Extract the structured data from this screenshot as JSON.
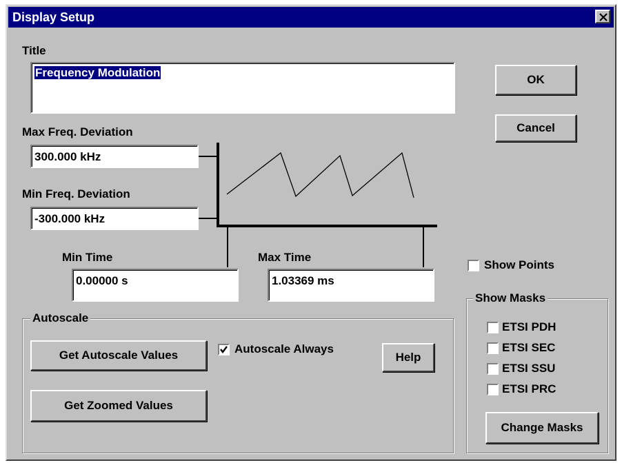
{
  "window": {
    "title": "Display Setup",
    "close_symbol": "✕"
  },
  "title_section": {
    "label": "Title",
    "value": "Frequency Modulation"
  },
  "buttons": {
    "ok": "OK",
    "cancel": "Cancel"
  },
  "max_freq": {
    "label": "Max Freq. Deviation",
    "value": "300.000 kHz"
  },
  "min_freq": {
    "label": "Min Freq. Deviation",
    "value": "-300.000 kHz"
  },
  "min_time": {
    "label": "Min Time",
    "value": "0.00000 s"
  },
  "max_time": {
    "label": "Max Time",
    "value": "1.03369 ms"
  },
  "autoscale": {
    "group_label": "Autoscale",
    "get_autoscale": "Get Autoscale Values",
    "get_zoomed": "Get Zoomed Values",
    "always_label": "Autoscale Always",
    "always_checked": true,
    "help": "Help"
  },
  "show_points": {
    "label": "Show Points",
    "checked": false
  },
  "masks": {
    "group_label": "Show Masks",
    "items": [
      {
        "label": "ETSI PDH",
        "checked": false
      },
      {
        "label": "ETSI SEC",
        "checked": false
      },
      {
        "label": "ETSI SSU",
        "checked": false
      },
      {
        "label": "ETSI PRC",
        "checked": false
      }
    ],
    "change_button": "Change Masks"
  },
  "colors": {
    "face": "#c0c0c0",
    "titlebar": "#000080",
    "selection": "#000080"
  }
}
